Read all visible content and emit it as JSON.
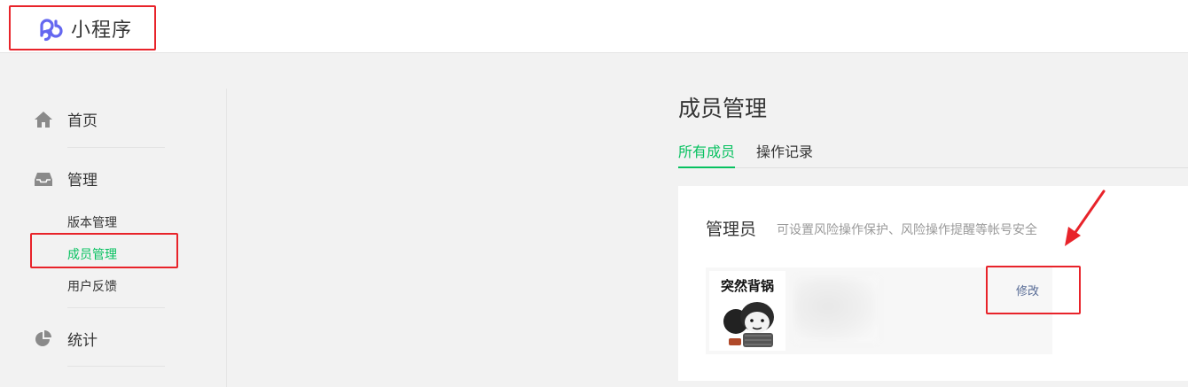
{
  "header": {
    "app_name": "小程序",
    "logo_icon": "miniprogram-logo-icon",
    "brand_color": "#6467f0"
  },
  "sidebar": {
    "items": [
      {
        "label": "首页",
        "icon": "home-icon"
      },
      {
        "label": "管理",
        "icon": "inbox-icon"
      },
      {
        "label": "统计",
        "icon": "pie-chart-icon"
      }
    ],
    "sub_items": [
      {
        "label": "版本管理"
      },
      {
        "label": "成员管理",
        "active": true
      },
      {
        "label": "用户反馈"
      }
    ]
  },
  "main": {
    "title": "成员管理",
    "tabs": [
      {
        "label": "所有成员",
        "active": true
      },
      {
        "label": "操作记录",
        "active": false
      }
    ],
    "card": {
      "title": "管理员",
      "description": "可设置风险操作保护、风险操作提醒等帐号安全",
      "member": {
        "avatar_caption": "突然背锅",
        "edit_label": "修改"
      }
    }
  },
  "colors": {
    "accent": "#07c160",
    "link": "#576b95",
    "highlight": "#e8232a"
  }
}
